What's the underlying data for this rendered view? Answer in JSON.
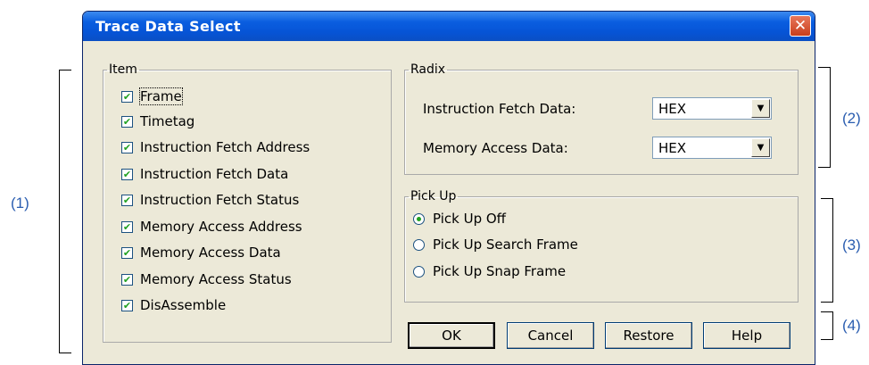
{
  "dialog": {
    "title": "Trace Data Select",
    "close_glyph": "✕"
  },
  "item_group": {
    "legend": "Item",
    "items": [
      {
        "label": "Frame",
        "checked": true
      },
      {
        "label": "Timetag",
        "checked": true
      },
      {
        "label": "Instruction Fetch Address",
        "checked": true
      },
      {
        "label": "Instruction Fetch Data",
        "checked": true
      },
      {
        "label": "Instruction Fetch Status",
        "checked": true
      },
      {
        "label": "Memory Access Address",
        "checked": true
      },
      {
        "label": "Memory Access Data",
        "checked": true
      },
      {
        "label": "Memory Access Status",
        "checked": true
      },
      {
        "label": "DisAssemble",
        "checked": true
      }
    ]
  },
  "radix_group": {
    "legend": "Radix",
    "fetch_label": "Instruction Fetch Data:",
    "fetch_value": "HEX",
    "memory_label": "Memory Access Data:",
    "memory_value": "HEX"
  },
  "pickup_group": {
    "legend": "Pick Up",
    "options": [
      {
        "label": "Pick Up Off",
        "selected": true
      },
      {
        "label": "Pick Up Search Frame",
        "selected": false
      },
      {
        "label": "Pick Up Snap Frame",
        "selected": false
      }
    ]
  },
  "buttons": {
    "ok": "OK",
    "cancel": "Cancel",
    "restore": "Restore",
    "help": "Help"
  },
  "annotations": {
    "a1": "(1)",
    "a2": "(2)",
    "a3": "(3)",
    "a4": "(4)"
  },
  "colors": {
    "titlebar": "#0654d6",
    "annotation": "#2a5db0",
    "check": "#21a121"
  }
}
